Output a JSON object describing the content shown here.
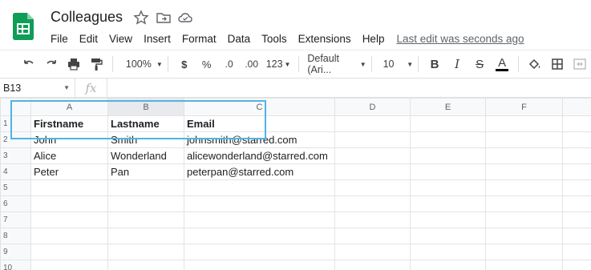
{
  "app": {
    "title": "Colleagues",
    "last_edit": "Last edit was seconds ago"
  },
  "menu": [
    "File",
    "Edit",
    "View",
    "Insert",
    "Format",
    "Data",
    "Tools",
    "Extensions",
    "Help"
  ],
  "toolbar": {
    "zoom": "100%",
    "currency": "$",
    "percent": "%",
    "decrease_decimal": ".0",
    "increase_decimal": ".00",
    "more_formats": "123",
    "font": "Default (Ari...",
    "font_size": "10",
    "bold": "B",
    "italic": "I",
    "strike": "S",
    "text_color": "A"
  },
  "formula": {
    "cell_ref": "B13",
    "fx": "fx",
    "value": ""
  },
  "grid": {
    "columns": [
      "A",
      "B",
      "C",
      "D",
      "E",
      "F"
    ],
    "rows": [
      {
        "num": "1",
        "cells": [
          "Firstname",
          "Lastname",
          "Email",
          "",
          "",
          ""
        ]
      },
      {
        "num": "2",
        "cells": [
          "John",
          "Smith",
          "johnsmith@starred.com",
          "",
          "",
          ""
        ]
      },
      {
        "num": "3",
        "cells": [
          "Alice",
          "Wonderland",
          "alicewonderland@starred.com",
          "",
          "",
          ""
        ]
      },
      {
        "num": "4",
        "cells": [
          "Peter",
          "Pan",
          "peterpan@starred.com",
          "",
          "",
          ""
        ]
      },
      {
        "num": "5",
        "cells": [
          "",
          "",
          "",
          "",
          "",
          ""
        ]
      },
      {
        "num": "6",
        "cells": [
          "",
          "",
          "",
          "",
          "",
          ""
        ]
      },
      {
        "num": "7",
        "cells": [
          "",
          "",
          "",
          "",
          "",
          ""
        ]
      },
      {
        "num": "8",
        "cells": [
          "",
          "",
          "",
          "",
          "",
          ""
        ]
      },
      {
        "num": "9",
        "cells": [
          "",
          "",
          "",
          "",
          "",
          ""
        ]
      },
      {
        "num": "10",
        "cells": [
          "",
          "",
          "",
          "",
          "",
          ""
        ]
      }
    ]
  },
  "colors": {
    "sheets_green": "#0f9d58",
    "highlight": "#4fb3e8"
  }
}
